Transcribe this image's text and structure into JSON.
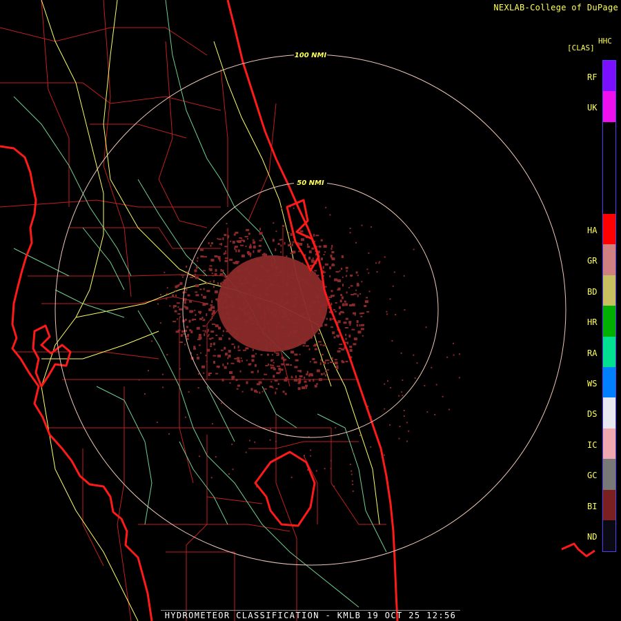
{
  "header": {
    "credit": "NEXLAB-College of DuPage"
  },
  "rings": [
    {
      "label": "100 NMI"
    },
    {
      "label": "50 NMI"
    }
  ],
  "legend": {
    "product": "HHC",
    "field": "[CLAS]",
    "classes": [
      {
        "code": "RF",
        "color": "#7a10ff"
      },
      {
        "code": "UK",
        "color": "#ee10ee"
      },
      {
        "code": "",
        "color": "#000000"
      },
      {
        "code": "",
        "color": "#000000"
      },
      {
        "code": "",
        "color": "#000000"
      },
      {
        "code": "HA",
        "color": "#ff0000"
      },
      {
        "code": "GR",
        "color": "#d08080"
      },
      {
        "code": "BD",
        "color": "#c8c060"
      },
      {
        "code": "HR",
        "color": "#00b000"
      },
      {
        "code": "RA",
        "color": "#00e090"
      },
      {
        "code": "WS",
        "color": "#0080ff"
      },
      {
        "code": "DS",
        "color": "#e8e8f0"
      },
      {
        "code": "IC",
        "color": "#f0a8b0"
      },
      {
        "code": "GC",
        "color": "#787878"
      },
      {
        "code": "BI",
        "color": "#7a2020"
      },
      {
        "code": "ND",
        "color": "#0a0a14"
      }
    ]
  },
  "colors": {
    "coast": "#ff1a1a",
    "county": "#c02020",
    "roads_primary": "#ffff66",
    "roads_secondary": "#70d090",
    "ring": "#f0c8b8",
    "echo_bi": "#8b2a2a"
  },
  "footer": {
    "caption": "HYDROMETEOR CLASSIFICATION - KMLB 19 OCT 25 12:56"
  }
}
